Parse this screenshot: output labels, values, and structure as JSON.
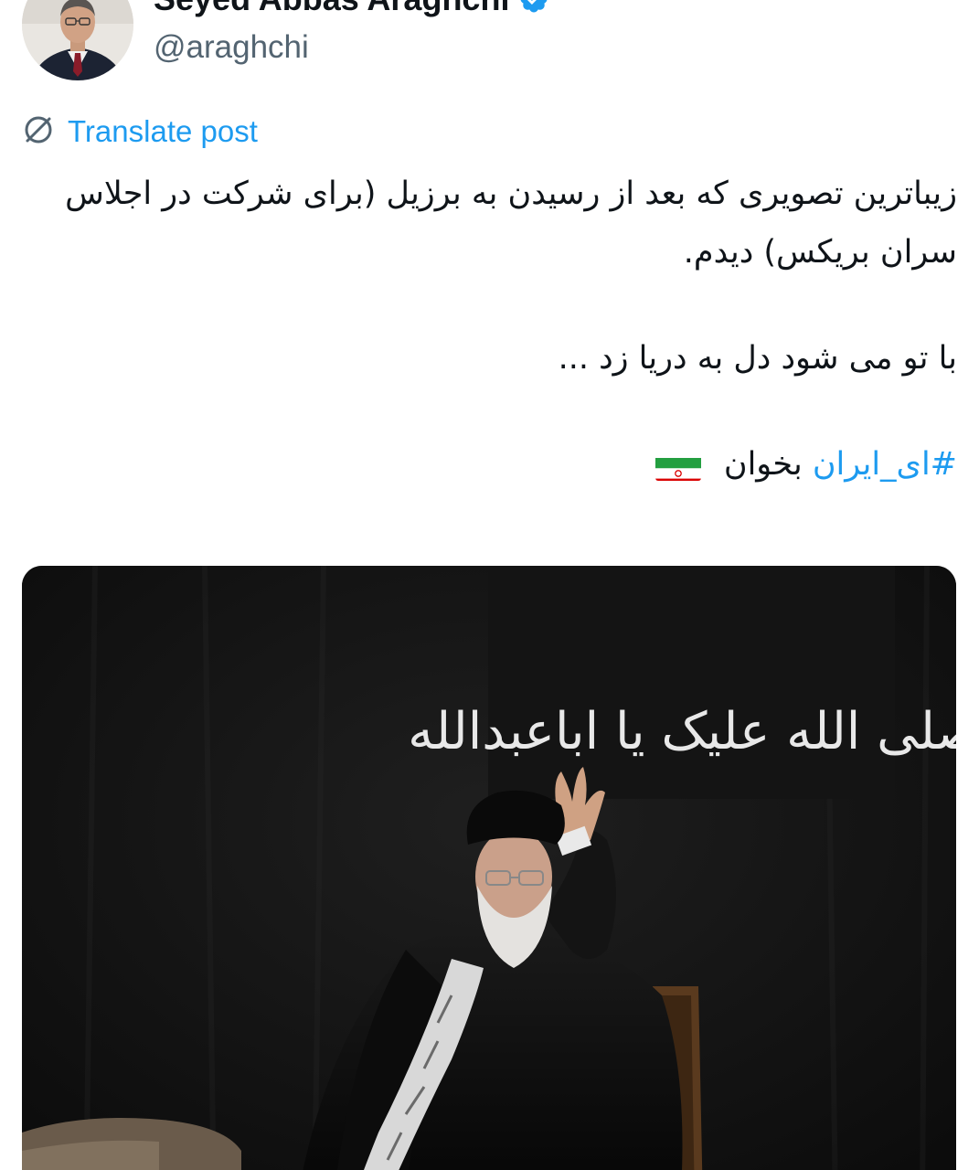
{
  "author": {
    "display_name": "Seyed Abbas Araghchi",
    "handle": "@araghchi",
    "verified": true,
    "avatar_icon": "profile-photo"
  },
  "translate": {
    "label": "Translate post",
    "icon": "translate-globe-icon"
  },
  "post": {
    "line1": "زیباترین تصویری که بعد از رسیدن به برزیل (برای شرکت در اجلاس سران بریکس) دیدم.",
    "line2": "با تو می شود دل به دریا زد ...",
    "hashtag": "#ای_ایران",
    "after_hashtag": "بخوان",
    "flag_icon": "iran-flag-emoji"
  },
  "media": {
    "banner_text": "صلی الله علیک یا اباعبدالله",
    "background_color": "#111111"
  },
  "colors": {
    "link": "#1d9bf0",
    "text": "#0f1419",
    "secondary": "#536471"
  }
}
